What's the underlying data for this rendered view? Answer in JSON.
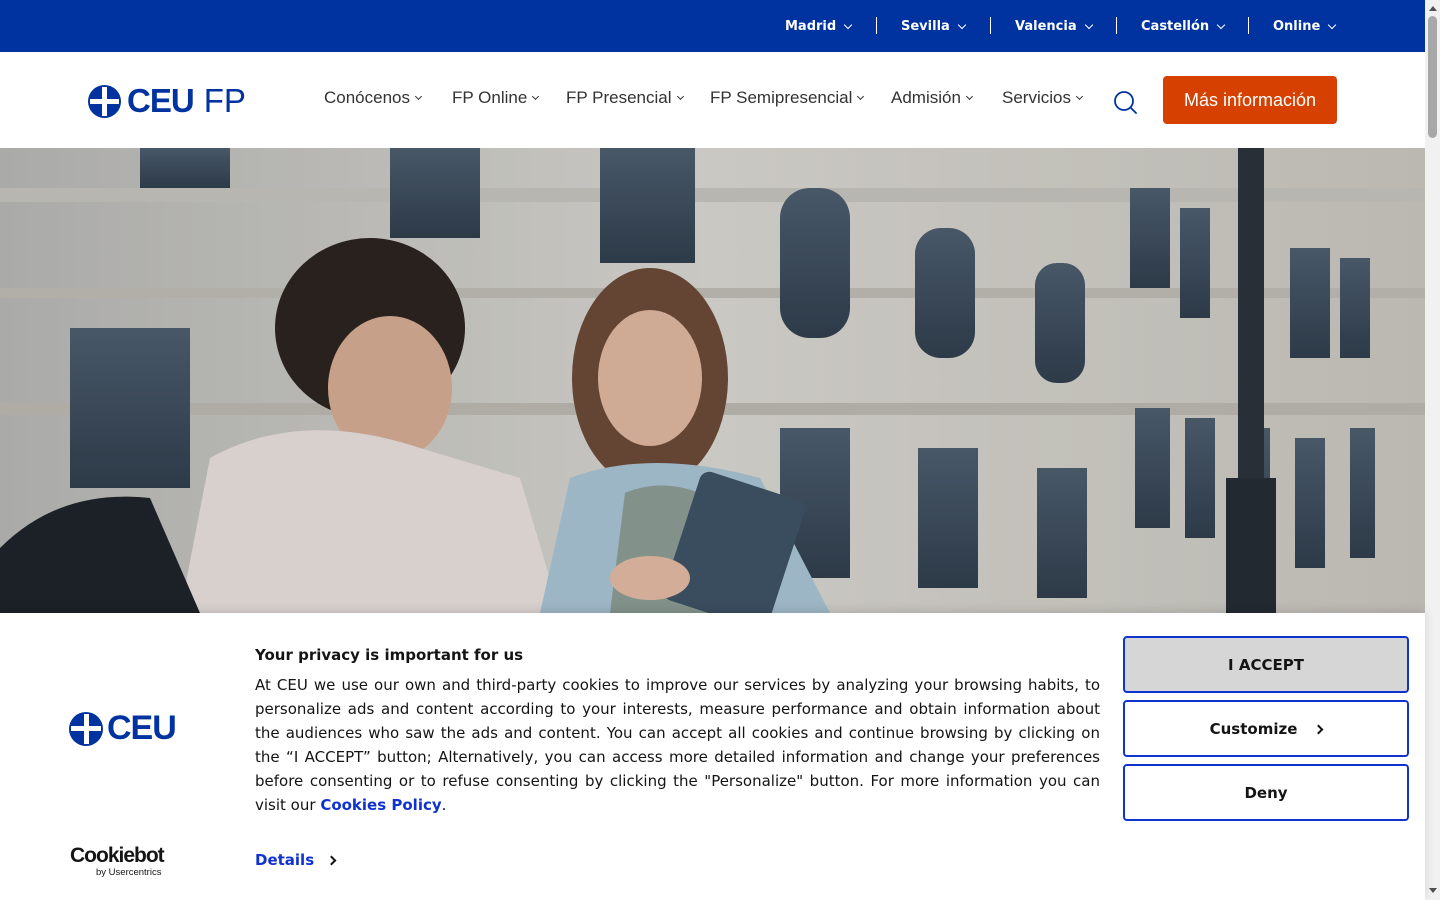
{
  "topbar": {
    "campuses": [
      {
        "label": "Madrid"
      },
      {
        "label": "Sevilla"
      },
      {
        "label": "Valencia"
      },
      {
        "label": "Castellón"
      },
      {
        "label": "Online"
      }
    ]
  },
  "header": {
    "logo": {
      "ceu": "CEU",
      "fp": "FP"
    },
    "nav": [
      {
        "label": "Conócenos"
      },
      {
        "label": "FP Online"
      },
      {
        "label": "FP Presencial"
      },
      {
        "label": "FP Semipresencial"
      },
      {
        "label": "Admisión"
      },
      {
        "label": "Servicios"
      }
    ],
    "search_icon": "search-icon",
    "cta_label": "Más información"
  },
  "colors": {
    "brand_blue": "#0033a0",
    "cta_orange": "#d64000",
    "link_blue": "#1032cf"
  },
  "cookie_banner": {
    "logo_text": "CEU",
    "cookiebot_brand": "Cookiebot",
    "cookiebot_by": "by Usercentrics",
    "title": "Your privacy is important for us",
    "body_text": "At CEU we use our own and third-party cookies to improve our services by analyzing your browsing habits, to personalize ads and content according to your interests, measure performance and obtain information about the audiences who saw the ads and content. You can accept all cookies and continue browsing by clicking on the “I ACCEPT” button; Alternatively, you can access more detailed information and change your preferences before consenting or to refuse consenting by clicking the \"Personalize\" button. For more information you can visit our",
    "policy_link": "Cookies Policy",
    "body_end": ".",
    "details_label": "Details",
    "accept_label": "I ACCEPT",
    "customize_label": "Customize",
    "deny_label": "Deny"
  }
}
